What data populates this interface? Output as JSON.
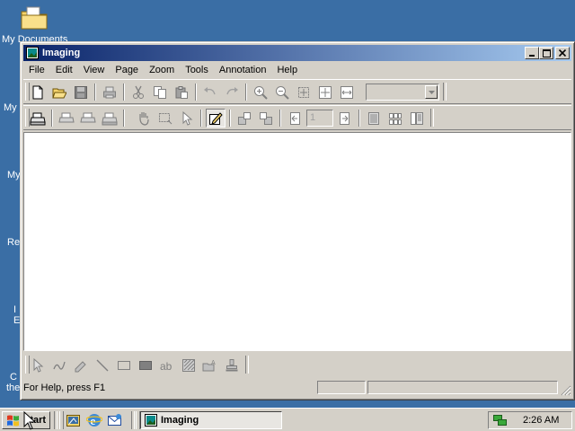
{
  "desktop": {
    "icons": [
      {
        "label": "My Documents",
        "icon": "folder-icon"
      },
      {
        "label": "My",
        "icon": "computer-icon"
      },
      {
        "label": "My",
        "icon": "network-icon"
      },
      {
        "label": "Re",
        "icon": "recycle-bin-icon"
      },
      {
        "label": "I",
        "icon": "internet-explorer-icon"
      },
      {
        "label": "E",
        "icon": "internet-explorer-icon-2"
      },
      {
        "label": "C",
        "icon": "connect-icon"
      },
      {
        "label": "the",
        "icon": "connect-icon-2"
      }
    ]
  },
  "window": {
    "title": "Imaging",
    "menu": [
      "File",
      "Edit",
      "View",
      "Page",
      "Zoom",
      "Tools",
      "Annotation",
      "Help"
    ],
    "page_number": "1",
    "zoom_value": "",
    "status": "For Help, press F1"
  },
  "taskbar": {
    "start_label": "Start",
    "task_label": "Imaging",
    "clock": "2:26 AM"
  },
  "colors": {
    "desktop": "#3a6ea5",
    "face": "#d4d0c8",
    "title_start": "#0a246a",
    "title_end": "#a6caf0"
  }
}
